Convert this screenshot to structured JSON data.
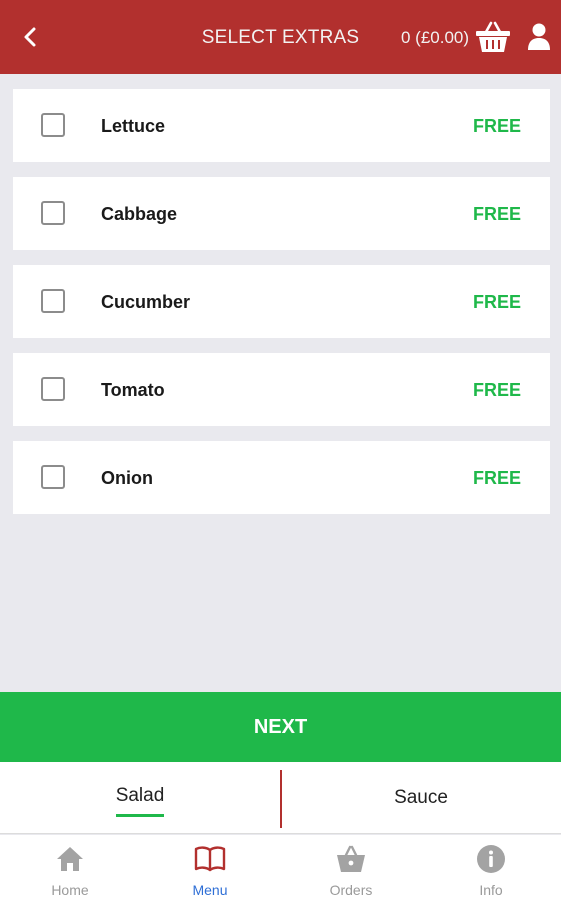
{
  "header": {
    "back_icon": "chevron-left-icon",
    "title": "SELECT EXTRAS",
    "cart_summary": "0 (£0.00)",
    "basket_icon": "basket-icon",
    "user_icon": "user-icon"
  },
  "extras": [
    {
      "name": "Lettuce",
      "price": "FREE",
      "checked": false
    },
    {
      "name": "Cabbage",
      "price": "FREE",
      "checked": false
    },
    {
      "name": "Cucumber",
      "price": "FREE",
      "checked": false
    },
    {
      "name": "Tomato",
      "price": "FREE",
      "checked": false
    },
    {
      "name": "Onion",
      "price": "FREE",
      "checked": false
    }
  ],
  "next_label": "NEXT",
  "steps": {
    "salad": "Salad",
    "sauce": "Sauce",
    "active": "Salad"
  },
  "nav": {
    "home": "Home",
    "menu": "Menu",
    "orders": "Orders",
    "info": "Info",
    "active": "Menu"
  },
  "colors": {
    "header_bg": "#b2302e",
    "accent_green": "#1fb84a",
    "active_nav": "#2f6fd6",
    "inactive_nav": "#9a9a9a",
    "page_bg": "#e9e9ee"
  }
}
